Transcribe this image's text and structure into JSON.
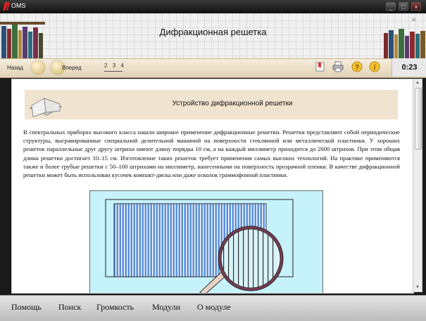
{
  "window": {
    "app_name": "OMS",
    "minimize": "_",
    "maximize": "□",
    "close": "×"
  },
  "header": {
    "title": "Дифракционная решетка",
    "corner_close": "×"
  },
  "toolbar": {
    "back_label": "Назад",
    "forward_label": "Вперед",
    "pages": [
      "2",
      "3",
      "4"
    ],
    "icons": [
      "bookmark-icon",
      "print-icon",
      "help-icon",
      "info-icon"
    ],
    "timer": "0:23"
  },
  "content": {
    "section_title": "Устройство дифракционной решетки",
    "paragraph": "В спектральных приборах высокого класса нашли широкое применение дифракционные решетки. Решетки представляют собой периодические структуры, выгравированные специальной делительной машиной на поверхности стеклянной или металлической пластинки. У хороших решеток параллельные друг другу штрихи имеют длину порядка 10 см, а на каждый миллиметр приходится до 2000 штрихов. При этом общая длина решетки достигает 10–15 см. Изготовление таких решеток требует применения самых высоких технологий. На практике применяются также и более грубые решетки с 50–100 штрихами на миллиметр, нанесенными на поверхность прозрачной пленки. В качестве дифракционной решетки может быть использован кусочек компакт-диска или даже осколок граммофонной пластинки."
  },
  "bottom_menu": [
    "Помощь",
    "Поиск",
    "Громкость",
    "Модули",
    "О модуле"
  ]
}
